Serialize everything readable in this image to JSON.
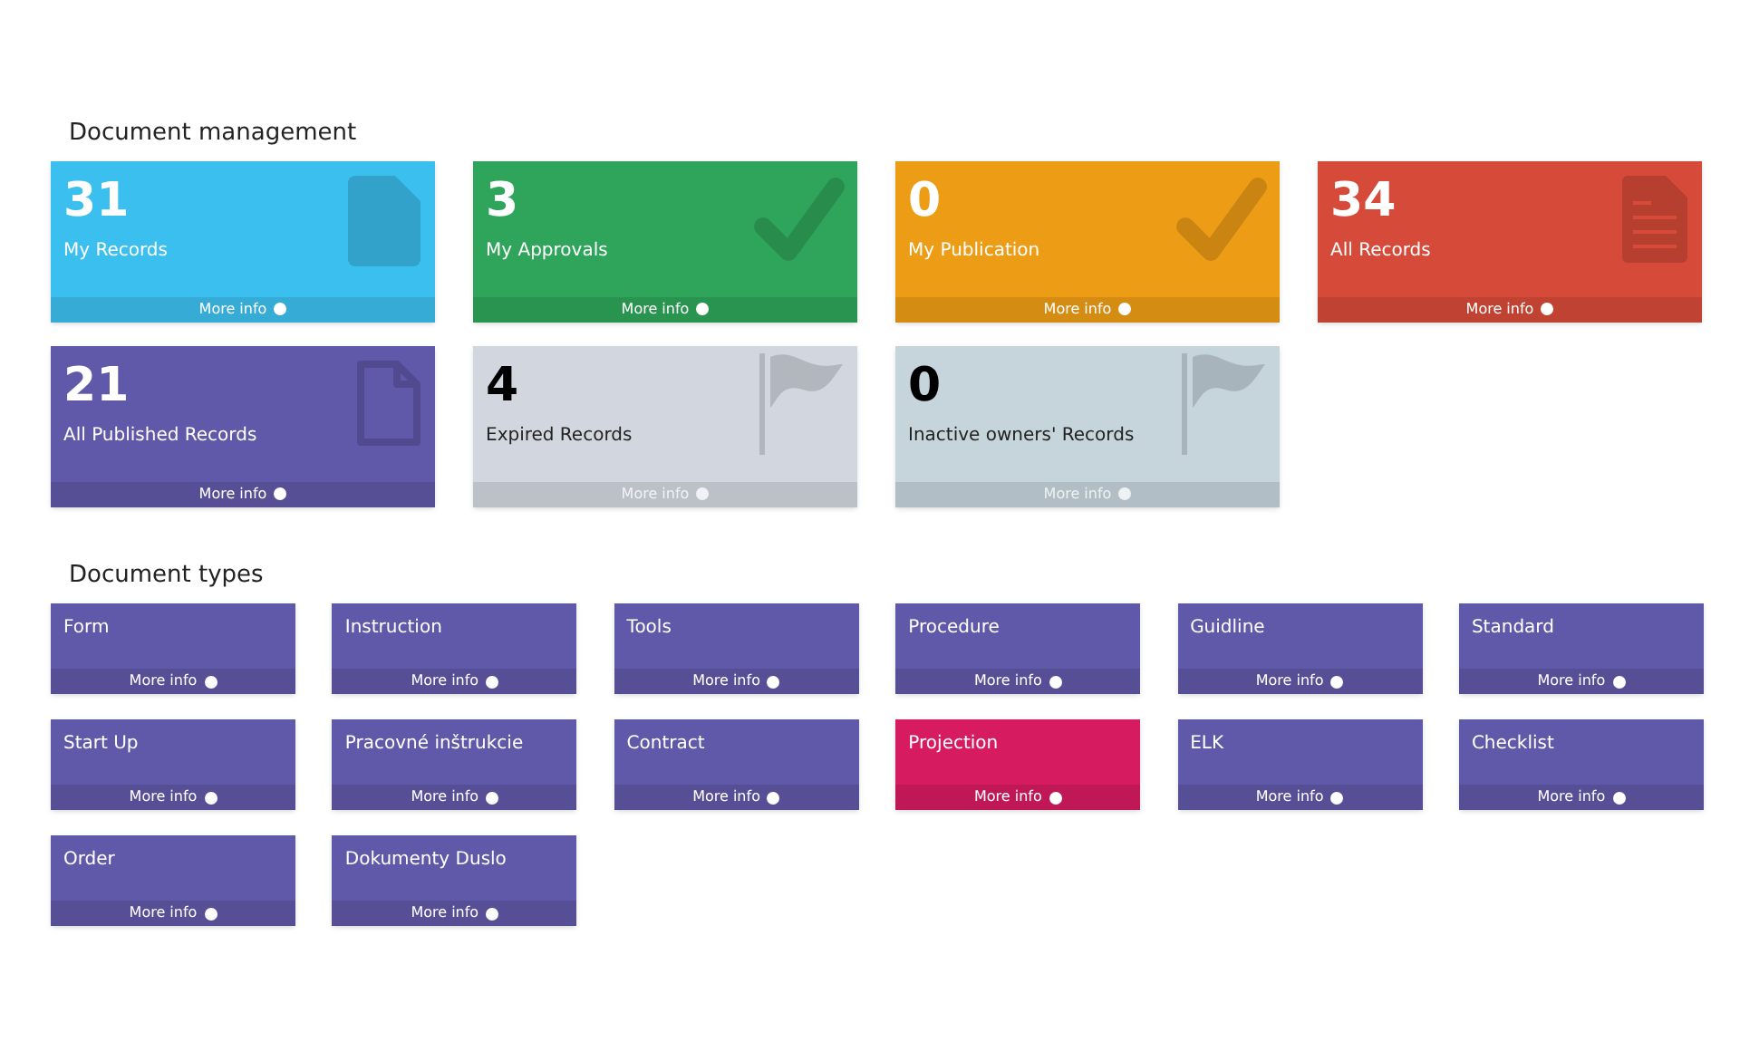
{
  "management": {
    "title": "Document management",
    "cards": [
      {
        "count": "31",
        "label": "My Records",
        "link": "More info",
        "color": "#3bbfee",
        "kind": "file"
      },
      {
        "count": "3",
        "label": "My Approvals",
        "link": "More info",
        "color": "#2ea55a",
        "kind": "check"
      },
      {
        "count": "0",
        "label": "My Publication",
        "link": "More info",
        "color": "#ed9c16",
        "kind": "check"
      },
      {
        "count": "34",
        "label": "All Records",
        "link": "More info",
        "color": "#d64a39",
        "kind": "document"
      },
      {
        "count": "21",
        "label": "All Published Records",
        "link": "More info",
        "color": "#6058a8",
        "kind": "file-outline"
      },
      {
        "count": "4",
        "label": "Expired Records",
        "link": "More info",
        "color": "#d2d6de",
        "kind": "flag"
      },
      {
        "count": "0",
        "label": "Inactive owners' Records",
        "link": "More info",
        "color": "#c6d4dc",
        "kind": "flag"
      }
    ]
  },
  "types": {
    "title": "Document types",
    "cards": [
      {
        "label": "Form",
        "link": "More info",
        "color": "#6058a8"
      },
      {
        "label": "Instruction",
        "link": "More info",
        "color": "#6058a8"
      },
      {
        "label": "Tools",
        "link": "More info",
        "color": "#6058a8"
      },
      {
        "label": "Procedure",
        "link": "More info",
        "color": "#6058a8"
      },
      {
        "label": "Guidline",
        "link": "More info",
        "color": "#6058a8"
      },
      {
        "label": "Standard",
        "link": "More info",
        "color": "#6058a8"
      },
      {
        "label": "Start Up",
        "link": "More info",
        "color": "#6058a8"
      },
      {
        "label": "Pracovné inštrukcie",
        "link": "More info",
        "color": "#6058a8"
      },
      {
        "label": "Contract",
        "link": "More info",
        "color": "#6058a8"
      },
      {
        "label": "Projection",
        "link": "More info",
        "color": "#d61b60"
      },
      {
        "label": "ELK",
        "link": "More info",
        "color": "#6058a8"
      },
      {
        "label": "Checklist",
        "link": "More info",
        "color": "#6058a8"
      },
      {
        "label": "Order",
        "link": "More info",
        "color": "#6058a8"
      },
      {
        "label": "Dokumenty Duslo",
        "link": "More info",
        "color": "#6058a8"
      }
    ]
  }
}
